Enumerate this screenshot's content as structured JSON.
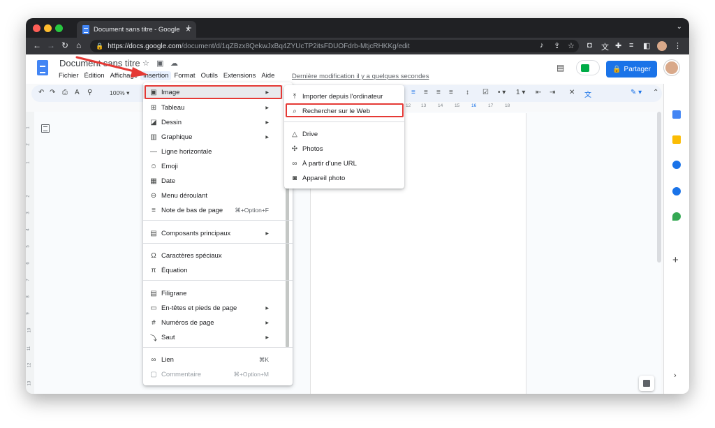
{
  "browser": {
    "tab_title": "Document sans titre - Google Docs",
    "tab_close": "×",
    "new_tab": "+",
    "url_host": "https://docs.google.com",
    "url_path": "/document/d/1qZBzx8QekwJxBq4ZYUcTP2itsFDUOFdrb-MtjcRHKKg/edit"
  },
  "docs": {
    "title": "Document sans titre",
    "menus": [
      "Fichier",
      "Édition",
      "Affichage",
      "Insertion",
      "Format",
      "Outils",
      "Extensions",
      "Aide"
    ],
    "last_modified": "Dernière modification il y a quelques secondes",
    "share_label": "Partager",
    "zoom": "100%"
  },
  "ruler": [
    "12",
    "13",
    "14",
    "15",
    "16",
    "17",
    "18"
  ],
  "vruler": [
    "1",
    "2",
    "1",
    "2",
    "3",
    "4",
    "5",
    "6",
    "7",
    "8",
    "9",
    "10",
    "11",
    "12",
    "13"
  ],
  "insert_menu": {
    "items": [
      {
        "label": "Image",
        "icon": "image-icon",
        "glyph": "▣",
        "arrow": true
      },
      {
        "label": "Tableau",
        "icon": "table-icon",
        "glyph": "⊞",
        "arrow": true
      },
      {
        "label": "Dessin",
        "icon": "drawing-icon",
        "glyph": "◪",
        "arrow": true
      },
      {
        "label": "Graphique",
        "icon": "chart-icon",
        "glyph": "▥",
        "arrow": true
      },
      {
        "label": "Ligne horizontale",
        "icon": "horizontal-line-icon",
        "glyph": "—"
      },
      {
        "label": "Emoji",
        "icon": "emoji-icon",
        "glyph": "☺"
      },
      {
        "label": "Date",
        "icon": "date-icon",
        "glyph": "▦"
      },
      {
        "label": "Menu déroulant",
        "icon": "dropdown-icon",
        "glyph": "⊖"
      },
      {
        "label": "Note de bas de page",
        "icon": "footnote-icon",
        "glyph": "≡",
        "shortcut": "⌘+Option+F"
      },
      {
        "label": "Composants principaux",
        "icon": "building-blocks-icon",
        "glyph": "▤",
        "arrow": true
      },
      {
        "label": "Caractères spéciaux",
        "icon": "omega-icon",
        "glyph": "Ω"
      },
      {
        "label": "Équation",
        "icon": "pi-icon",
        "glyph": "π"
      },
      {
        "label": "Filigrane",
        "icon": "watermark-icon",
        "glyph": "▤"
      },
      {
        "label": "En-têtes et pieds de page",
        "icon": "header-footer-icon",
        "glyph": "▭",
        "arrow": true
      },
      {
        "label": "Numéros de page",
        "icon": "page-number-icon",
        "glyph": "#",
        "arrow": true
      },
      {
        "label": "Saut",
        "icon": "break-icon",
        "glyph": "⤵",
        "arrow": true
      },
      {
        "label": "Lien",
        "icon": "link-icon",
        "glyph": "∞",
        "shortcut": "⌘K"
      },
      {
        "label": "Commentaire",
        "icon": "comment-icon",
        "glyph": "▢",
        "shortcut": "⌘+Option+M",
        "disabled": true
      }
    ]
  },
  "image_submenu": {
    "items": [
      {
        "label": "Importer depuis l'ordinateur",
        "icon": "upload-icon",
        "glyph": "⤒"
      },
      {
        "label": "Rechercher sur le Web",
        "icon": "search-icon",
        "glyph": "⌕"
      },
      {
        "label": "Drive",
        "icon": "drive-icon",
        "glyph": "△"
      },
      {
        "label": "Photos",
        "icon": "photos-icon",
        "glyph": "✣"
      },
      {
        "label": "À partir d'une URL",
        "icon": "link-icon",
        "glyph": "∞"
      },
      {
        "label": "Appareil photo",
        "icon": "camera-icon",
        "glyph": "◙"
      }
    ]
  },
  "colors": {
    "highlight_red": "#e53935",
    "share_blue": "#1a73e8",
    "docs_blue": "#4285f4"
  }
}
